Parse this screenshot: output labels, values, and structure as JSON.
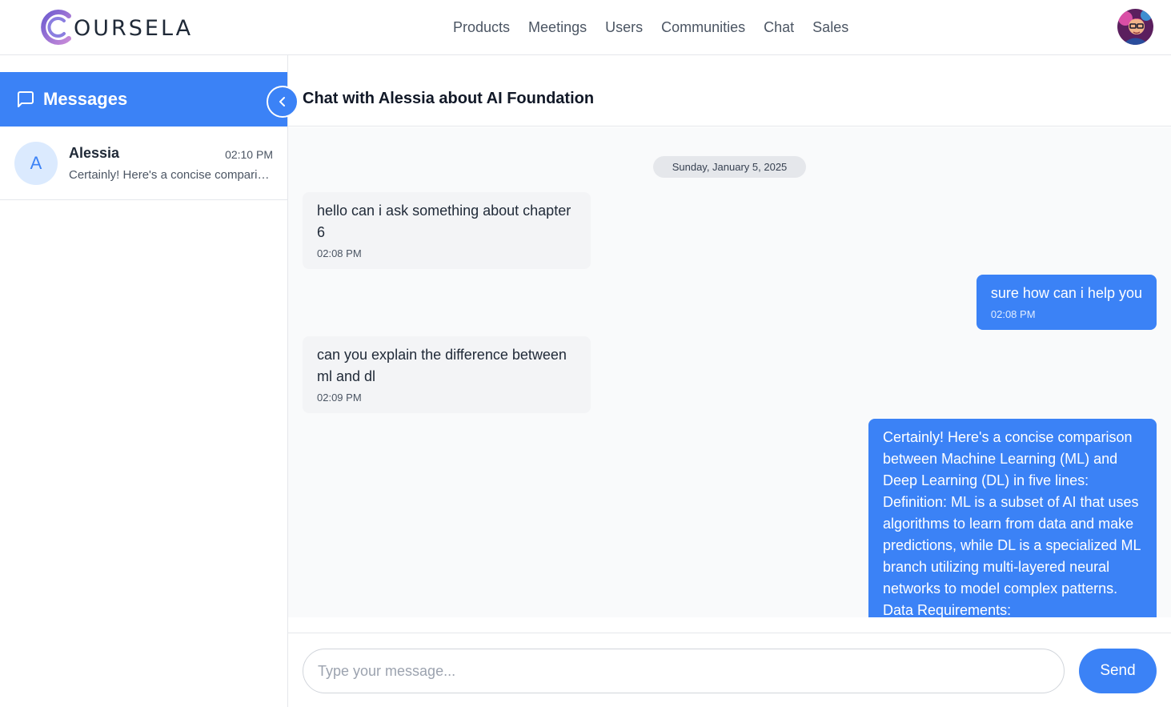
{
  "brand": {
    "name": "OURSELA",
    "accent": "#3b82f6"
  },
  "nav": {
    "links": [
      "Products",
      "Meetings",
      "Users",
      "Communities",
      "Chat",
      "Sales"
    ]
  },
  "sidebar": {
    "title": "Messages",
    "conversations": [
      {
        "initial": "A",
        "name": "Alessia",
        "time": "02:10 PM",
        "preview": "Certainly! Here's a concise comparison between Machine Learning (ML) and Deep Learning (DL) in five lines:"
      }
    ]
  },
  "chat": {
    "title": "Chat with Alessia about AI Foundation",
    "date_divider": "Sunday, January 5, 2025",
    "messages": [
      {
        "direction": "incoming",
        "text": "hello can i ask something about chapter 6",
        "time": "02:08 PM"
      },
      {
        "direction": "outgoing",
        "text": "sure how can i help you",
        "time": "02:08 PM"
      },
      {
        "direction": "incoming",
        "text": "can you explain the difference between ml and dl",
        "time": "02:09 PM"
      },
      {
        "direction": "outgoing",
        "text": "Certainly! Here's a concise comparison between Machine Learning (ML) and Deep Learning (DL) in five lines: Definition: ML is a subset of AI that uses algorithms to learn from data and make predictions, while DL is a specialized ML branch utilizing multi-layered neural networks to model complex patterns. Data Requirements:",
        "time": ""
      }
    ]
  },
  "composer": {
    "placeholder": "Type your message...",
    "value": "",
    "send_label": "Send"
  }
}
